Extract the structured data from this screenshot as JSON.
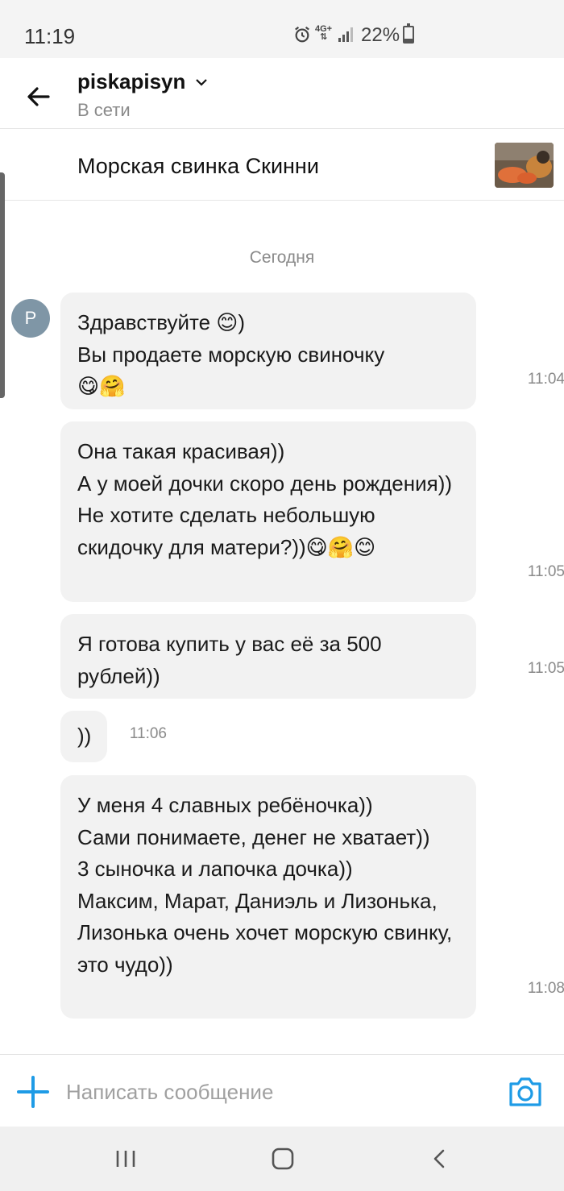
{
  "status_bar": {
    "time": "11:19",
    "network": "4G+",
    "battery": "22%",
    "battery_level": 0.22
  },
  "header": {
    "contact_name": "piskapisyn",
    "contact_status": "В сети"
  },
  "listing": {
    "title": "Морская свинка Скинни"
  },
  "chat": {
    "date_separator": "Сегодня",
    "avatar_letter": "P",
    "messages": [
      {
        "text": "Здравствуйте 😊)\nВы продаете морскую свиночку\n😋🤗",
        "time": "11:04"
      },
      {
        "text": "Она такая красивая))\nА у моей дочки скоро день рождения))\nНе хотите сделать небольшую скидочку для матери?))😋🤗😊",
        "time": "11:05"
      },
      {
        "text": "Я готова купить у вас её за 500 рублей))",
        "time": "11:05"
      },
      {
        "text": "))",
        "time": "11:06"
      },
      {
        "text": "У меня 4 славных ребёночка))\nСами понимаете, денег не хватает))\n3 сыночка и лапочка дочка))\nМаксим, Марат, Даниэль и Лизонька, Лизонька очень хочет морскую свинку, это чудо))",
        "time": "11:08"
      }
    ]
  },
  "composer": {
    "placeholder": "Написать сообщение"
  },
  "colors": {
    "accent": "#1e9be6",
    "bubble": "#f2f2f2",
    "avatar": "#7f96a6"
  }
}
